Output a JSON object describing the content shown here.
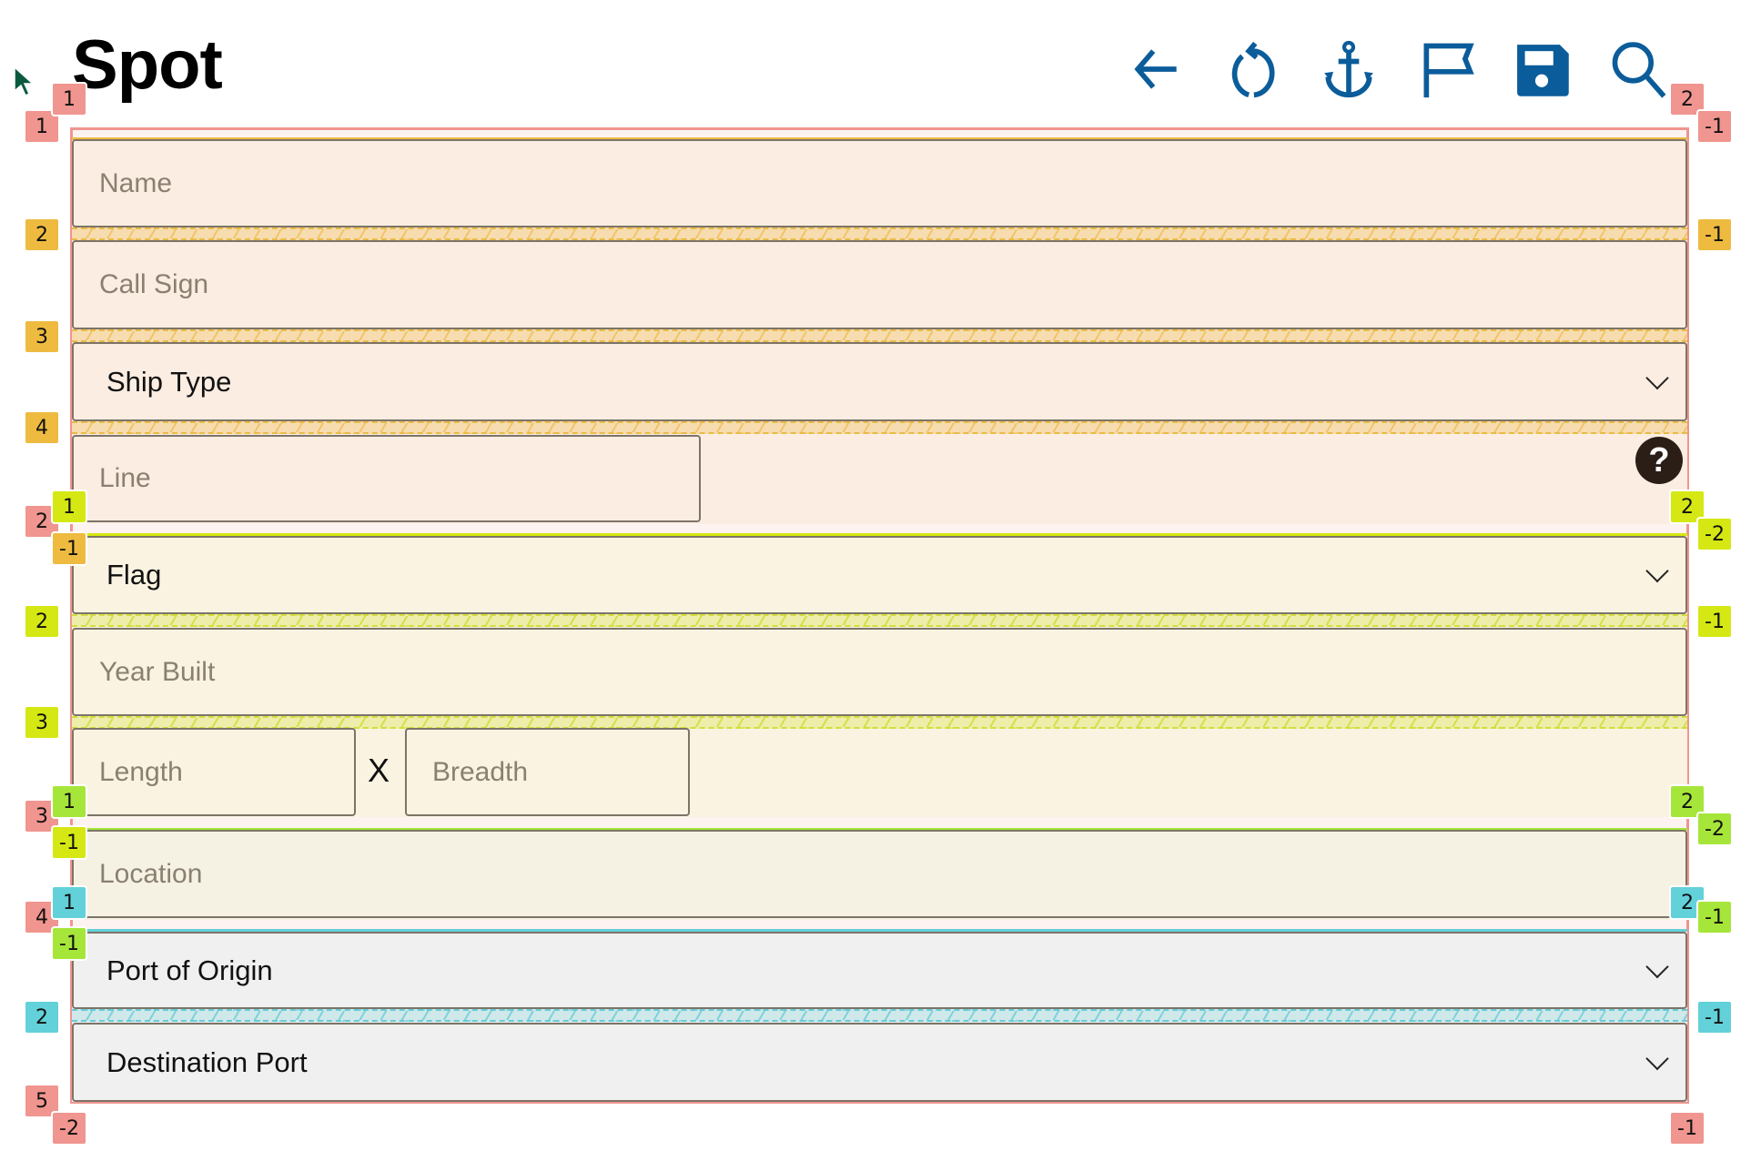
{
  "header": {
    "title": "Spot",
    "toolbar": [
      {
        "icon": "back-arrow-icon"
      },
      {
        "icon": "refresh-icon"
      },
      {
        "icon": "anchor-icon"
      },
      {
        "icon": "flag-icon"
      },
      {
        "icon": "save-icon"
      },
      {
        "icon": "search-icon"
      }
    ]
  },
  "form": {
    "name_placeholder": "Name",
    "call_sign_placeholder": "Call Sign",
    "ship_type": "Ship Type",
    "line_placeholder": "Line",
    "help_icon": "?",
    "flag": "Flag",
    "year_built_placeholder": "Year Built",
    "length_placeholder": "Length",
    "times": "X",
    "breadth_placeholder": "Breadth",
    "location_placeholder": "Location",
    "port_of_origin": "Port of Origin",
    "destination_port": "Destination Port"
  },
  "colors": {
    "icon": "#0b5c9a",
    "red": "#f0958f",
    "orange": "#eebb40",
    "yellow_green": "#d5e813",
    "green": "#a6e63a",
    "cyan": "#63d1d9"
  },
  "badges": [
    "1",
    "2",
    "3",
    "4",
    "2",
    "2",
    "3",
    "3",
    "4",
    "2",
    "5",
    "1",
    "1",
    "-1",
    "1",
    "-1",
    "1",
    "-1",
    "-2",
    "2",
    "2",
    "2",
    "2",
    "-1",
    "-1",
    "-1",
    "-2",
    "-1",
    "-2",
    "-1",
    "-1"
  ]
}
